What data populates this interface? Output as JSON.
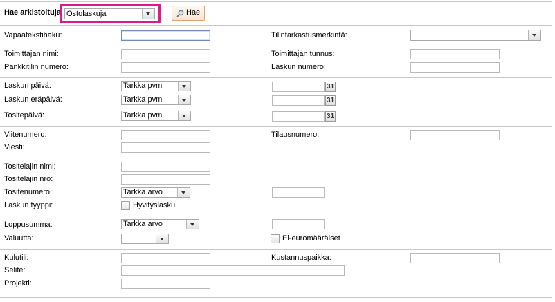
{
  "header": {
    "search_label": "Hae arkistoituja",
    "archive_select_value": "Ostolaskuja",
    "search_button": "Hae",
    "search_button_icon": "magnifier-icon"
  },
  "sections": {
    "freetext": {
      "vapaateksti_label": "Vapaatekstihaku:",
      "tilintarkastus_label": "Tilintarkastusmerkintä:"
    },
    "supplier": {
      "toimittajan_nimi_label": "Toimittajan nimi:",
      "toimittajan_tunnus_label": "Toimittajan tunnus:",
      "pankkitili_label": "Pankkitilin numero:",
      "laskun_numero_label": "Laskun numero:"
    },
    "dates": {
      "laskun_paiva_label": "Laskun päivä:",
      "laskun_paiva_select": "Tarkka pvm",
      "erapaiva_label": "Laskun eräpäivä:",
      "erapaiva_select": "Tarkka pvm",
      "tositepaiva_label": "Tositepäivä:",
      "tositepaiva_select": "Tarkka pvm",
      "calendar_glyph": "31"
    },
    "reference": {
      "viitenumero_label": "Viitenumero:",
      "tilausnumero_label": "Tilausnumero:",
      "viesti_label": "Viesti:"
    },
    "voucher": {
      "tositelajin_nimi_label": "Tositelajin nimi:",
      "tositelajin_nro_label": "Tositelajin nro:",
      "tositenumero_label": "Tositenumero:",
      "tositenumero_select": "Tarkka arvo",
      "laskun_tyyppi_label": "Laskun tyyppi:",
      "hyvityslasku_label": "Hyvityslasku"
    },
    "amount": {
      "loppusumma_label": "Loppusumma:",
      "loppusumma_select": "Tarkka arvo",
      "valuutta_label": "Valuutta:",
      "valuutta_select": "",
      "ei_euro_label": "Ei-euromääräiset"
    },
    "accounting": {
      "kulutili_label": "Kulutili:",
      "kustannuspaikka_label": "Kustannuspaikka:",
      "selite_label": "Selite:",
      "projekti_label": "Projekti:"
    }
  }
}
